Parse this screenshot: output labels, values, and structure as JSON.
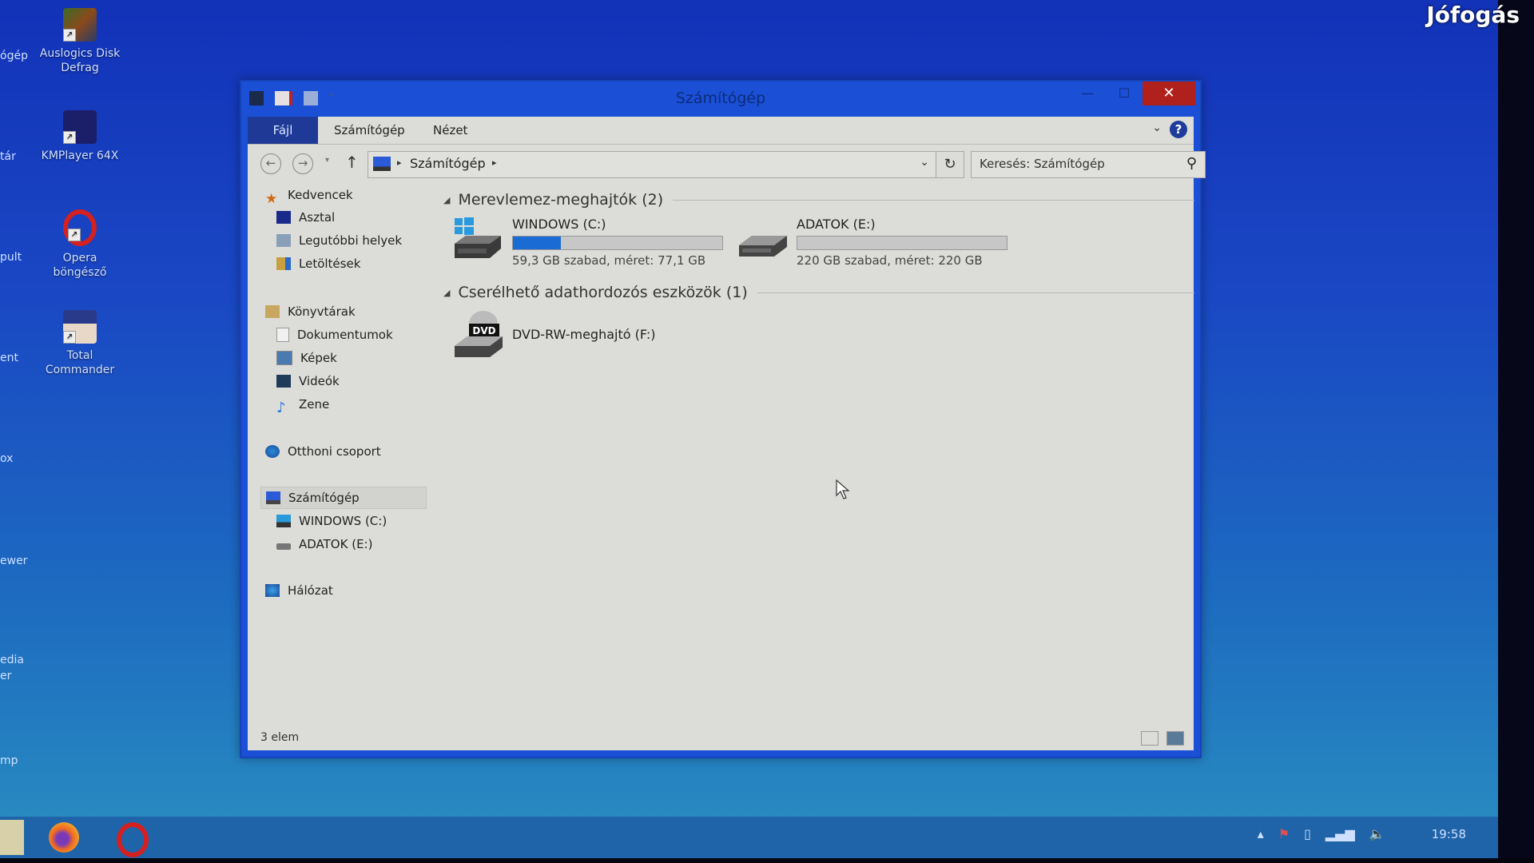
{
  "watermark": "Jófogás",
  "desktop": {
    "icons": [
      {
        "label_line1": "Auslogics Disk",
        "label_line2": "Defrag",
        "icon": "auslogics-defrag-icon"
      },
      {
        "label_line1": "KMPlayer 64X",
        "label_line2": "",
        "icon": "kmplayer-icon"
      },
      {
        "label_line1": "Opera",
        "label_line2": "böngésző",
        "icon": "opera-icon"
      },
      {
        "label_line1": "Total",
        "label_line2": "Commander",
        "icon": "total-commander-icon"
      }
    ],
    "partial_labels": [
      "ógép",
      "tár",
      "pult",
      "ent",
      "ox",
      "ewer",
      "edia",
      "er",
      "mp"
    ]
  },
  "window": {
    "title": "Számítógép",
    "controls": {
      "minimize": "—",
      "maximize": "☐",
      "close": "✕"
    },
    "ribbon": {
      "tabs": [
        "Fájl",
        "Számítógép",
        "Nézet"
      ],
      "expand_icon": "⌄",
      "help_icon": "?"
    },
    "nav": {
      "back": "←",
      "forward": "→",
      "recent": "▾",
      "up": "↑",
      "breadcrumb": [
        "Számítógép"
      ],
      "refresh": "↻",
      "search_placeholder": "Keresés: Számítógép"
    },
    "navpane": {
      "favorites": {
        "label": "Kedvencek",
        "items": [
          "Asztal",
          "Legutóbbi helyek",
          "Letöltések"
        ]
      },
      "libraries": {
        "label": "Könyvtárak",
        "items": [
          "Dokumentumok",
          "Képek",
          "Videók",
          "Zene"
        ]
      },
      "homegroup": {
        "label": "Otthoni csoport"
      },
      "computer": {
        "label": "Számítógép",
        "items": [
          "WINDOWS (C:)",
          "ADATOK (E:)"
        ]
      },
      "network": {
        "label": "Hálózat"
      }
    },
    "content": {
      "groups": [
        {
          "title": "Merevlemez-meghajtók (2)",
          "drives": [
            {
              "name": "WINDOWS (C:)",
              "info": "59,3 GB szabad, méret: 77,1 GB",
              "used_fraction": 0.23,
              "bar_color": "#1a6bd4"
            },
            {
              "name": "ADATOK (E:)",
              "info": "220 GB szabad, méret: 220 GB",
              "used_fraction": 0.0,
              "bar_color": "#1a6bd4"
            }
          ]
        },
        {
          "title": "Cserélhető adathordozós eszközök (1)",
          "drives": [
            {
              "name": "DVD-RW-meghajtó (F:)",
              "badge": "DVD"
            }
          ]
        }
      ]
    },
    "status": {
      "count": "3 elem"
    }
  },
  "taskbar": {
    "apps": [
      "file-explorer",
      "firefox",
      "opera"
    ],
    "clock": "19:58"
  }
}
